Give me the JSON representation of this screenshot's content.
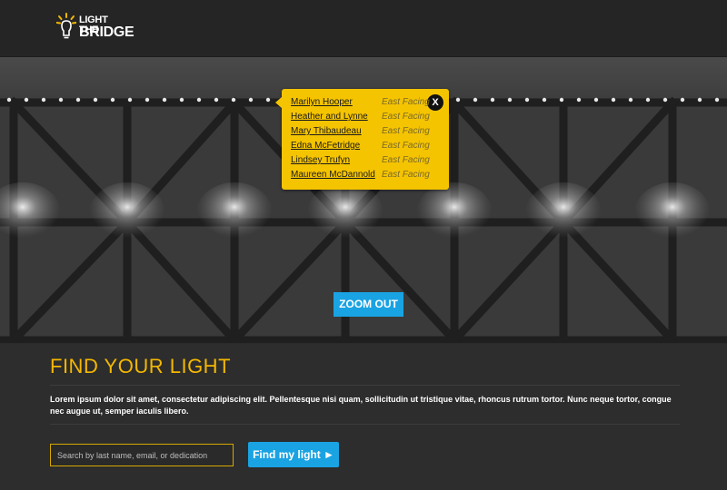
{
  "header": {
    "logo_line1": "LIGHT THE",
    "logo_line2": "BRIDGE"
  },
  "popup": {
    "close_label": "X",
    "entries": [
      {
        "name": "Marilyn Hooper",
        "facing": "East Facing"
      },
      {
        "name": "Heather and Lynne",
        "facing": "East Facing"
      },
      {
        "name": "Mary Thibaudeau",
        "facing": "East Facing"
      },
      {
        "name": "Edna McFetridge",
        "facing": "East Facing"
      },
      {
        "name": "Lindsey Trufyn",
        "facing": "East Facing"
      },
      {
        "name": "Maureen McDannold",
        "facing": "East Facing"
      }
    ]
  },
  "hero": {
    "zoom_label": "ZOOM OUT"
  },
  "find": {
    "title": "FIND YOUR LIGHT",
    "description": "Lorem ipsum dolor sit amet, consectetur adipiscing elit. Pellentesque nisi quam, sollicitudin ut tristique vitae, rhoncus rutrum tortor. Nunc neque tortor, congue nec augue ut, semper iaculis libero.",
    "search_placeholder": "Search by last name, email, or dedication",
    "search_value": "",
    "button_label": "Find my light ►"
  },
  "colors": {
    "accent_yellow": "#f5b800",
    "popup_yellow": "#f5c400",
    "button_blue": "#1aa3e3",
    "background": "#2b2b2b"
  },
  "icons": [
    "light-bulb-logo-icon",
    "close-icon",
    "play-arrow-icon"
  ]
}
